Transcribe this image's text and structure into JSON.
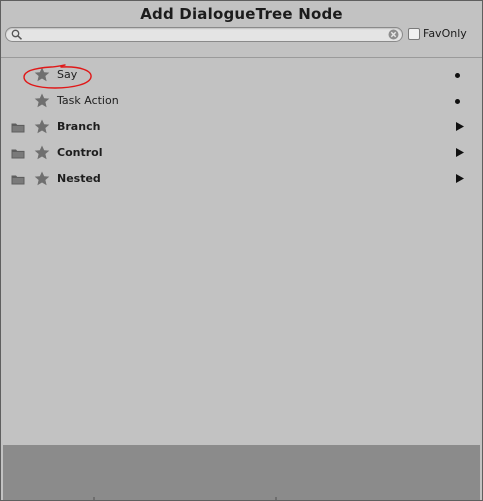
{
  "window": {
    "title": "Add DialogueTree Node"
  },
  "search": {
    "value": "",
    "placeholder": "",
    "icon": "search-icon",
    "clear_icon": "clear-icon"
  },
  "fav_only": {
    "label": "FavOnly",
    "checked": false
  },
  "nodes": [
    {
      "label": "Say",
      "bold": false,
      "folder": false,
      "indicator": "bullet"
    },
    {
      "label": "Task Action",
      "bold": false,
      "folder": false,
      "indicator": "bullet"
    },
    {
      "label": "Branch",
      "bold": true,
      "folder": true,
      "indicator": "arrow"
    },
    {
      "label": "Control",
      "bold": true,
      "folder": true,
      "indicator": "arrow"
    },
    {
      "label": "Nested",
      "bold": true,
      "folder": true,
      "indicator": "arrow"
    }
  ],
  "colors": {
    "background": "#c2c2c2",
    "footer": "#8b8b8b",
    "star": "#6f6f6f",
    "annotation": "#e01818"
  }
}
